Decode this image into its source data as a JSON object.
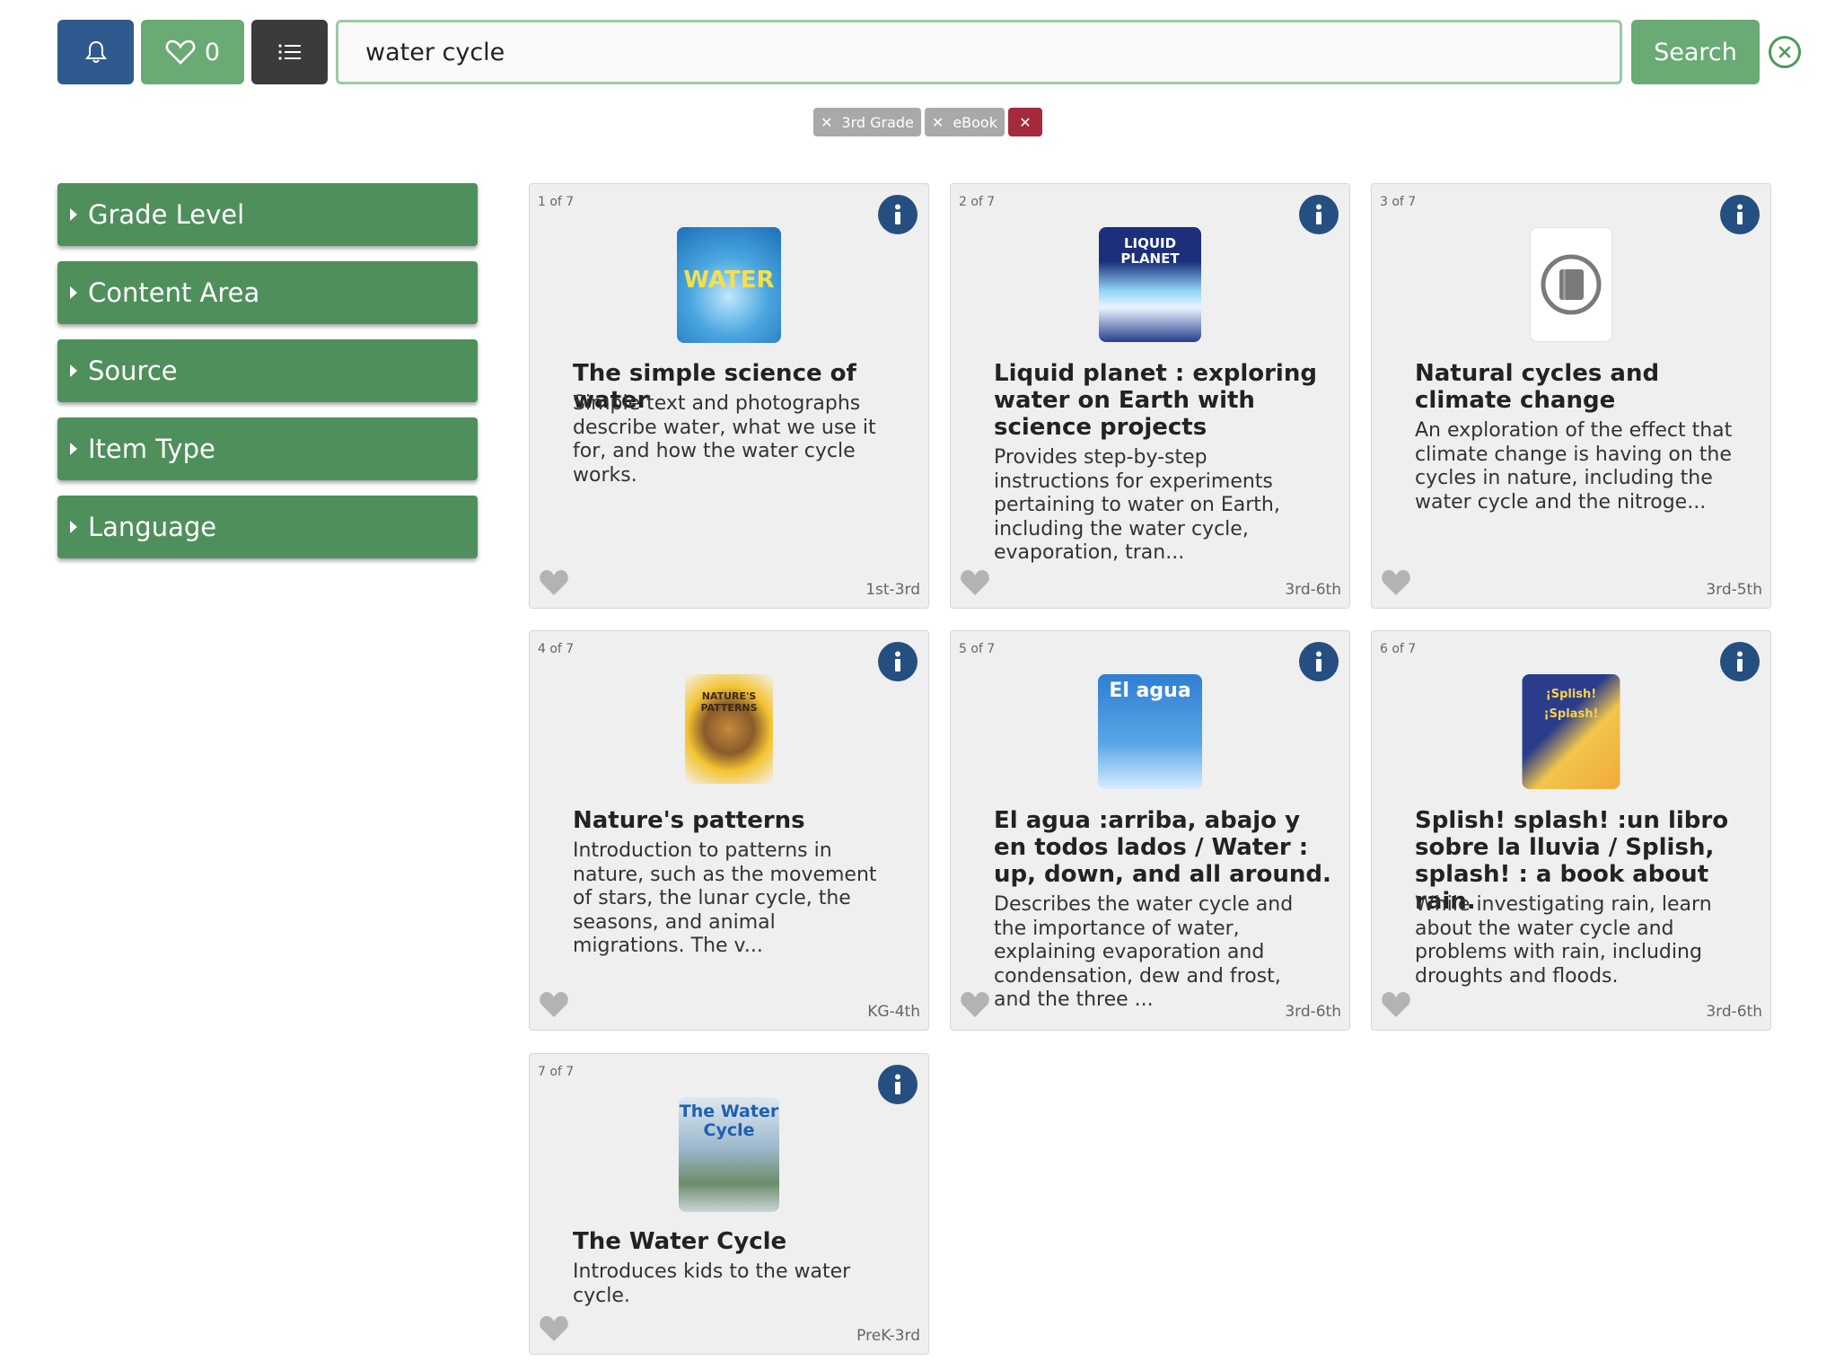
{
  "toolbar": {
    "favorites_count": "0",
    "search_value": "water cycle",
    "search_label": "Search"
  },
  "filters": {
    "chips": [
      {
        "label": "3rd Grade"
      },
      {
        "label": "eBook"
      }
    ]
  },
  "sidebar": {
    "facets": [
      {
        "label": "Grade Level"
      },
      {
        "label": "Content Area"
      },
      {
        "label": "Source"
      },
      {
        "label": "Item Type"
      },
      {
        "label": "Language"
      }
    ]
  },
  "results": [
    {
      "index": "1 of 7",
      "title": "The simple science of water",
      "description": "Simple text and photographs describe water, what we use it for, and how the water cycle works.",
      "grade": "1st-3rd",
      "cover_text": "WATER"
    },
    {
      "index": "2 of 7",
      "title": "Liquid planet : exploring water on Earth with science projects",
      "description": "Provides step-by-step instructions for experiments pertaining to water on Earth, including the water cycle, evaporation, tran...",
      "grade": "3rd-6th",
      "cover_text": "LIQUID PLANET"
    },
    {
      "index": "3 of 7",
      "title": "Natural cycles and climate change",
      "description": "An exploration of the effect that climate change is having on the cycles in nature, including the water cycle and the nitroge...",
      "grade": "3rd-5th"
    },
    {
      "index": "4 of 7",
      "title": "Nature's patterns",
      "description": "Introduction to patterns in nature, such as the movement of stars, the lunar cycle, the seasons, and animal migrations. The v...",
      "grade": "KG-4th",
      "cover_text": "NATURE'S PATTERNS"
    },
    {
      "index": "5 of 7",
      "title": "El agua :arriba, abajo y en todos lados / Water : up, down, and all around.",
      "description": "Describes the water cycle and the importance of water, explaining evaporation and condensation, dew and frost, and the three ...",
      "grade": "3rd-6th",
      "cover_text": "El agua"
    },
    {
      "index": "6 of 7",
      "title": "Splish! splash! :un libro sobre la lluvia / Splish, splash! : a book about rain.",
      "description": "While investigating rain, learn about the water cycle and problems with rain, including droughts and floods.",
      "grade": "3rd-6th",
      "cover_text": "¡Splish! ¡Splash!"
    },
    {
      "index": "7 of 7",
      "title": "The Water Cycle",
      "description": "Introduces kids to the water cycle.",
      "grade": "PreK-3rd",
      "cover_text": "The Water Cycle"
    }
  ],
  "colors": {
    "primary_green": "#6aaa74",
    "facet_green": "#4f8f5c",
    "navy": "#254f80",
    "dark": "#3b3b3b",
    "chip_gray": "#a9a9a9",
    "chip_clear_red": "#a52a3d"
  },
  "icons": {
    "notifications": "bell-icon",
    "favorites": "heart-icon",
    "list_view": "list-icon",
    "clear_search": "close-circle-icon",
    "info": "info-icon",
    "favorite_item": "heart-filled-icon",
    "facet_expand": "caret-right-icon",
    "no_cover": "book-placeholder-icon"
  }
}
